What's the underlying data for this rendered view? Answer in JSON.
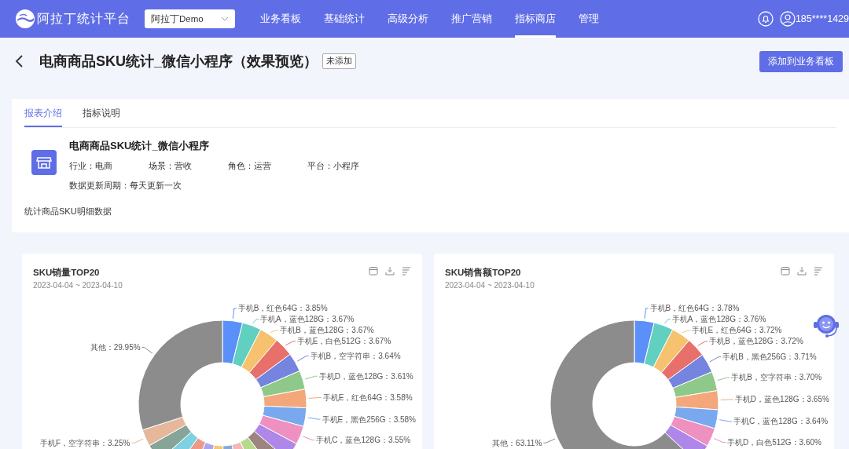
{
  "header": {
    "logo": "阿拉丁统计平台",
    "app_select": "阿拉丁Demo",
    "nav": [
      {
        "label": "业务看板",
        "selected": false
      },
      {
        "label": "基础统计",
        "selected": false
      },
      {
        "label": "高级分析",
        "selected": false
      },
      {
        "label": "推广营销",
        "selected": false
      },
      {
        "label": "指标商店",
        "selected": true
      },
      {
        "label": "管理",
        "selected": false
      }
    ],
    "user": "185****1429"
  },
  "page": {
    "title": "电商商品SKU统计_微信小程序（效果预览）",
    "status_badge": "未添加",
    "add_button": "添加到业务看板"
  },
  "info": {
    "tabs": [
      {
        "label": "报表介绍",
        "selected": true
      },
      {
        "label": "指标说明",
        "selected": false
      }
    ],
    "name": "电商商品SKU统计_微信小程序",
    "fields": [
      "行业：电商",
      "场景：营收",
      "角色：运营",
      "平台：小程序"
    ],
    "update": "数据更新周期：每天更新一次",
    "description": "统计商品SKU明细数据"
  },
  "charts": [
    {
      "title": "SKU销量TOP20",
      "date_range": "2023-04-04 ~ 2023-04-10",
      "slice_labels": [
        "手机B，红色64G：3.85%",
        "手机A，蓝色128G：3.67%",
        "手机B，蓝色128G：3.67%",
        "手机E，白色512G：3.67%",
        "手机B，空字符串：3.64%",
        "手机D，蓝色128G：3.61%",
        "手机E，红色64G：3.58%",
        "手机E，黑色256G：3.58%",
        "手机C，蓝色128G：3.55%",
        "其他：29.95%",
        "手机F，空字符串：3.25%"
      ]
    },
    {
      "title": "SKU销售额TOP20",
      "date_range": "2023-04-04 ~ 2023-04-10",
      "slice_labels": [
        "手机B，红色64G：3.78%",
        "手机A，蓝色128G：3.76%",
        "手机E，红色64G：3.72%",
        "手机B，蓝色128G：3.72%",
        "手机B，黑色256G：3.71%",
        "手机B，空字符串：3.70%",
        "手机D，蓝色128G：3.65%",
        "手机C，蓝色128G：3.64%",
        "其他：63.11%",
        "手机D，白色512G：3.60%"
      ]
    }
  ]
}
